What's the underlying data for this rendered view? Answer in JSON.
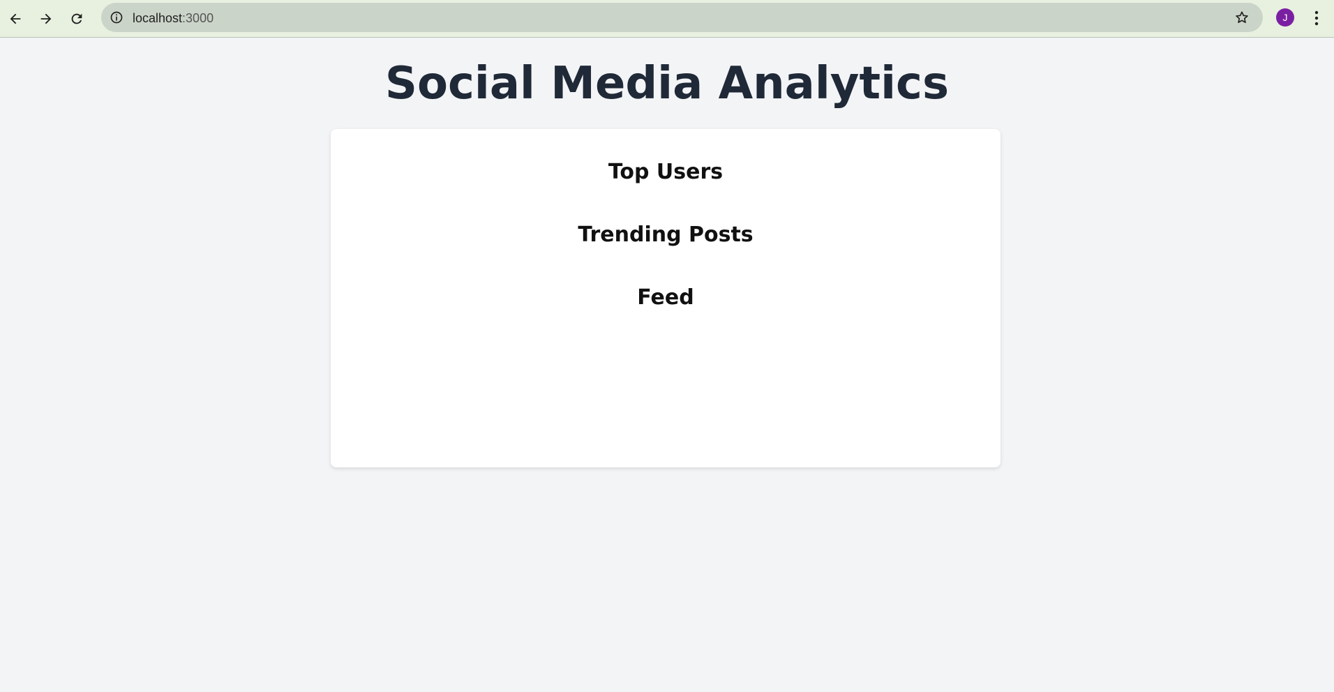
{
  "browser": {
    "url_host": "localhost",
    "url_port": ":3000",
    "avatar_letter": "J"
  },
  "page": {
    "title": "Social Media Analytics"
  },
  "sections": [
    {
      "label": "Top Users"
    },
    {
      "label": "Trending Posts"
    },
    {
      "label": "Feed"
    }
  ],
  "colors": {
    "page_background": "#f3f4f6",
    "title": "#1f2937",
    "avatar": "#7b1fa2",
    "toolbar": "#e8f0e0",
    "omnibox": "#cbd4c8"
  }
}
